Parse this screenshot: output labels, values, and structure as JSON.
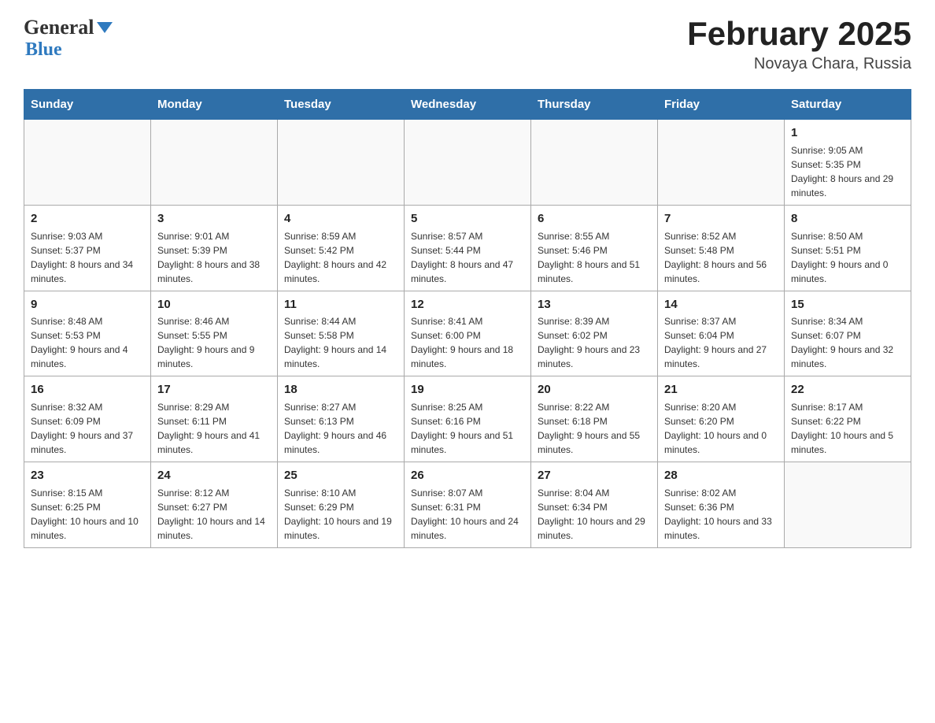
{
  "header": {
    "logo_general": "General",
    "logo_blue": "Blue",
    "month_title": "February 2025",
    "location": "Novaya Chara, Russia"
  },
  "weekdays": [
    "Sunday",
    "Monday",
    "Tuesday",
    "Wednesday",
    "Thursday",
    "Friday",
    "Saturday"
  ],
  "weeks": [
    [
      {
        "day": "",
        "info": ""
      },
      {
        "day": "",
        "info": ""
      },
      {
        "day": "",
        "info": ""
      },
      {
        "day": "",
        "info": ""
      },
      {
        "day": "",
        "info": ""
      },
      {
        "day": "",
        "info": ""
      },
      {
        "day": "1",
        "info": "Sunrise: 9:05 AM\nSunset: 5:35 PM\nDaylight: 8 hours and 29 minutes."
      }
    ],
    [
      {
        "day": "2",
        "info": "Sunrise: 9:03 AM\nSunset: 5:37 PM\nDaylight: 8 hours and 34 minutes."
      },
      {
        "day": "3",
        "info": "Sunrise: 9:01 AM\nSunset: 5:39 PM\nDaylight: 8 hours and 38 minutes."
      },
      {
        "day": "4",
        "info": "Sunrise: 8:59 AM\nSunset: 5:42 PM\nDaylight: 8 hours and 42 minutes."
      },
      {
        "day": "5",
        "info": "Sunrise: 8:57 AM\nSunset: 5:44 PM\nDaylight: 8 hours and 47 minutes."
      },
      {
        "day": "6",
        "info": "Sunrise: 8:55 AM\nSunset: 5:46 PM\nDaylight: 8 hours and 51 minutes."
      },
      {
        "day": "7",
        "info": "Sunrise: 8:52 AM\nSunset: 5:48 PM\nDaylight: 8 hours and 56 minutes."
      },
      {
        "day": "8",
        "info": "Sunrise: 8:50 AM\nSunset: 5:51 PM\nDaylight: 9 hours and 0 minutes."
      }
    ],
    [
      {
        "day": "9",
        "info": "Sunrise: 8:48 AM\nSunset: 5:53 PM\nDaylight: 9 hours and 4 minutes."
      },
      {
        "day": "10",
        "info": "Sunrise: 8:46 AM\nSunset: 5:55 PM\nDaylight: 9 hours and 9 minutes."
      },
      {
        "day": "11",
        "info": "Sunrise: 8:44 AM\nSunset: 5:58 PM\nDaylight: 9 hours and 14 minutes."
      },
      {
        "day": "12",
        "info": "Sunrise: 8:41 AM\nSunset: 6:00 PM\nDaylight: 9 hours and 18 minutes."
      },
      {
        "day": "13",
        "info": "Sunrise: 8:39 AM\nSunset: 6:02 PM\nDaylight: 9 hours and 23 minutes."
      },
      {
        "day": "14",
        "info": "Sunrise: 8:37 AM\nSunset: 6:04 PM\nDaylight: 9 hours and 27 minutes."
      },
      {
        "day": "15",
        "info": "Sunrise: 8:34 AM\nSunset: 6:07 PM\nDaylight: 9 hours and 32 minutes."
      }
    ],
    [
      {
        "day": "16",
        "info": "Sunrise: 8:32 AM\nSunset: 6:09 PM\nDaylight: 9 hours and 37 minutes."
      },
      {
        "day": "17",
        "info": "Sunrise: 8:29 AM\nSunset: 6:11 PM\nDaylight: 9 hours and 41 minutes."
      },
      {
        "day": "18",
        "info": "Sunrise: 8:27 AM\nSunset: 6:13 PM\nDaylight: 9 hours and 46 minutes."
      },
      {
        "day": "19",
        "info": "Sunrise: 8:25 AM\nSunset: 6:16 PM\nDaylight: 9 hours and 51 minutes."
      },
      {
        "day": "20",
        "info": "Sunrise: 8:22 AM\nSunset: 6:18 PM\nDaylight: 9 hours and 55 minutes."
      },
      {
        "day": "21",
        "info": "Sunrise: 8:20 AM\nSunset: 6:20 PM\nDaylight: 10 hours and 0 minutes."
      },
      {
        "day": "22",
        "info": "Sunrise: 8:17 AM\nSunset: 6:22 PM\nDaylight: 10 hours and 5 minutes."
      }
    ],
    [
      {
        "day": "23",
        "info": "Sunrise: 8:15 AM\nSunset: 6:25 PM\nDaylight: 10 hours and 10 minutes."
      },
      {
        "day": "24",
        "info": "Sunrise: 8:12 AM\nSunset: 6:27 PM\nDaylight: 10 hours and 14 minutes."
      },
      {
        "day": "25",
        "info": "Sunrise: 8:10 AM\nSunset: 6:29 PM\nDaylight: 10 hours and 19 minutes."
      },
      {
        "day": "26",
        "info": "Sunrise: 8:07 AM\nSunset: 6:31 PM\nDaylight: 10 hours and 24 minutes."
      },
      {
        "day": "27",
        "info": "Sunrise: 8:04 AM\nSunset: 6:34 PM\nDaylight: 10 hours and 29 minutes."
      },
      {
        "day": "28",
        "info": "Sunrise: 8:02 AM\nSunset: 6:36 PM\nDaylight: 10 hours and 33 minutes."
      },
      {
        "day": "",
        "info": ""
      }
    ]
  ]
}
